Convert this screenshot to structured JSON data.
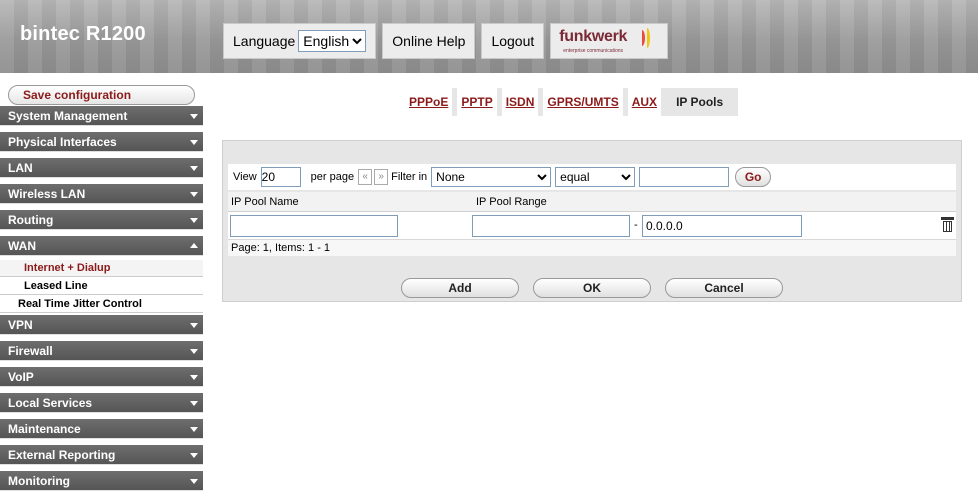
{
  "header": {
    "brand": "bintec R1200",
    "language_label": "Language",
    "language_value": "English",
    "online_help": "Online Help",
    "logout": "Logout",
    "logo_word": "funkwerk",
    "logo_sub": "enterprise communications"
  },
  "sidebar": {
    "save": "Save configuration",
    "items": [
      {
        "label": "System Management",
        "expanded": false
      },
      {
        "label": "Physical Interfaces",
        "expanded": false
      },
      {
        "label": "LAN",
        "expanded": false
      },
      {
        "label": "Wireless LAN",
        "expanded": false
      },
      {
        "label": "Routing",
        "expanded": false
      },
      {
        "label": "WAN",
        "expanded": true
      },
      {
        "label": "VPN",
        "expanded": false
      },
      {
        "label": "Firewall",
        "expanded": false
      },
      {
        "label": "VoIP",
        "expanded": false
      },
      {
        "label": "Local Services",
        "expanded": false
      },
      {
        "label": "Maintenance",
        "expanded": false
      },
      {
        "label": "External Reporting",
        "expanded": false
      },
      {
        "label": "Monitoring",
        "expanded": false
      }
    ],
    "wan_subitems": [
      {
        "label": "Internet + Dialup",
        "active": true
      },
      {
        "label": "Leased Line",
        "active": false
      },
      {
        "label": "Real Time Jitter Control",
        "active": false
      }
    ]
  },
  "tabs": [
    {
      "label": "PPPoE",
      "active": false
    },
    {
      "label": "PPTP",
      "active": false
    },
    {
      "label": "ISDN",
      "active": false
    },
    {
      "label": "GPRS/UMTS",
      "active": false
    },
    {
      "label": "AUX",
      "active": false
    },
    {
      "label": "IP Pools",
      "active": true
    }
  ],
  "toolbar": {
    "view_label": "View",
    "view_value": "20",
    "per_page": "per page",
    "prev": "«",
    "next": "»",
    "filter_in": "Filter in",
    "filter_field": "None",
    "filter_op": "equal",
    "filter_value": "",
    "go": "Go"
  },
  "table": {
    "columns": [
      "IP Pool Name",
      "IP Pool Range"
    ],
    "rows": [
      {
        "name": "",
        "range_start": "",
        "range_end": "0.0.0.0"
      }
    ],
    "range_sep": "-",
    "page_info": "Page: 1, Items: 1 - 1"
  },
  "buttons": {
    "add": "Add",
    "ok": "OK",
    "cancel": "Cancel"
  },
  "colors": {
    "accent": "#8b1a1a",
    "nav_bg": "#5f5f5f",
    "panel_bg": "#e6e6e6"
  }
}
